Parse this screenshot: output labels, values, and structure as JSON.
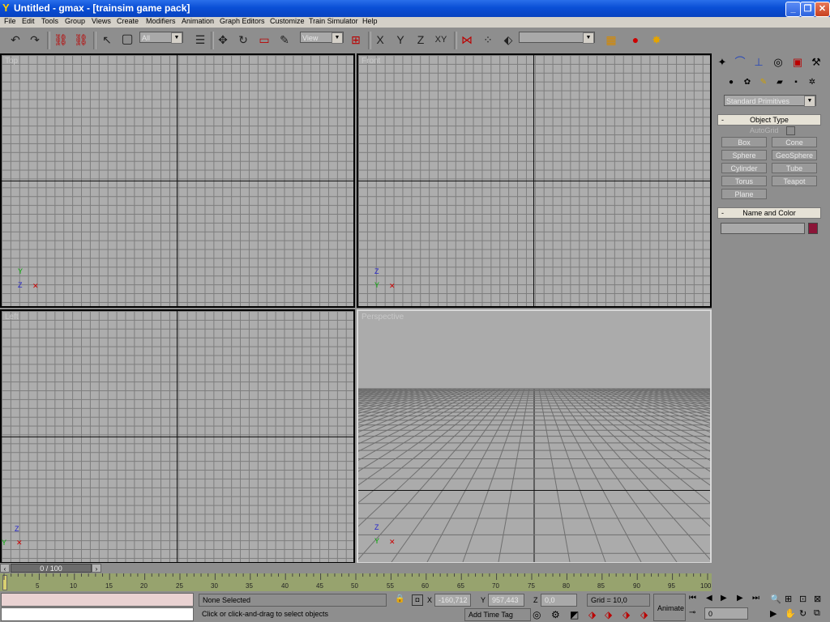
{
  "window": {
    "title": "Untitled - gmax - [trainsim game pack]"
  },
  "menu": [
    "File",
    "Edit",
    "Tools",
    "Group",
    "Views",
    "Create",
    "Modifiers",
    "Animation",
    "Graph Editors",
    "Customize",
    "Train Simulator",
    "Help"
  ],
  "toolbar": {
    "selection_filter": "All",
    "ref_coord": "View",
    "named_selection": "",
    "axis_x": "X",
    "axis_y": "Y",
    "axis_z": "Z",
    "axis_xy": "XY"
  },
  "viewports": {
    "top_left": "Top",
    "top_right": "Front",
    "bottom_left": "Left",
    "bottom_right": "Perspective"
  },
  "command_panel": {
    "category": "Standard Primitives",
    "object_type_header": "Object Type",
    "autogrid": "AutoGrid",
    "buttons": [
      "Box",
      "Cone",
      "Sphere",
      "GeoSphere",
      "Cylinder",
      "Tube",
      "Torus",
      "Teapot",
      "Plane"
    ],
    "name_color_header": "Name and Color",
    "swatch_color": "#8b1538"
  },
  "timeline": {
    "frame": "0 / 100",
    "ticks": [
      "5",
      "10",
      "15",
      "20",
      "25",
      "30",
      "35",
      "40",
      "45",
      "50",
      "55",
      "60",
      "65",
      "70",
      "75",
      "80",
      "85",
      "90",
      "95",
      "100"
    ]
  },
  "status": {
    "selection": "None Selected",
    "prompt": "Click or click-and-drag to select objects",
    "x_label": "X",
    "x_value": "-160,712",
    "y_label": "Y",
    "y_value": "957,443",
    "z_label": "Z",
    "z_value": "0,0",
    "grid": "Grid = 10,0",
    "add_time_tag": "Add Time Tag",
    "animate": "Animate",
    "current_frame": "0"
  }
}
